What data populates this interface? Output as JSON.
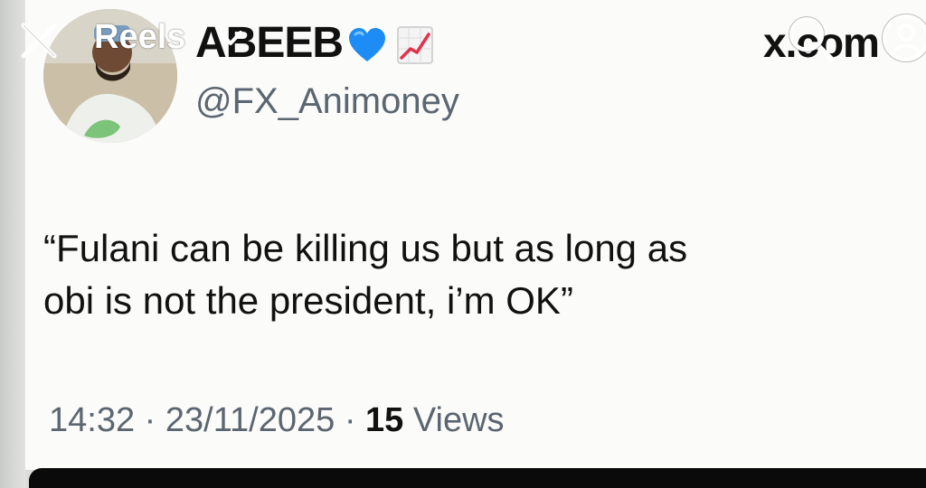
{
  "overlay": {
    "title": "Reels",
    "close_icon": "close-icon",
    "chevron_icon": "chevron-down-icon",
    "search_icon": "search-icon",
    "profile_icon": "profile-icon"
  },
  "tweet": {
    "display_name": "ABEEB",
    "badges": [
      "blue-heart-icon",
      "chart-increasing-icon"
    ],
    "handle": "@FX_Animoney",
    "site_label": "x.com",
    "text_line1": "“Fulani can be killing us but as long as",
    "text_line2": "obi is not the president, i’m OK”",
    "time": "14:32",
    "separator": "·",
    "date": "23/11/2025",
    "views_count": "15",
    "views_label": "Views"
  },
  "colors": {
    "card_bg": "#fbfbfa",
    "text": "#111111",
    "secondary_text": "#5b6670",
    "heart": "#1d8cf5",
    "chart_line": "#e0324a"
  }
}
